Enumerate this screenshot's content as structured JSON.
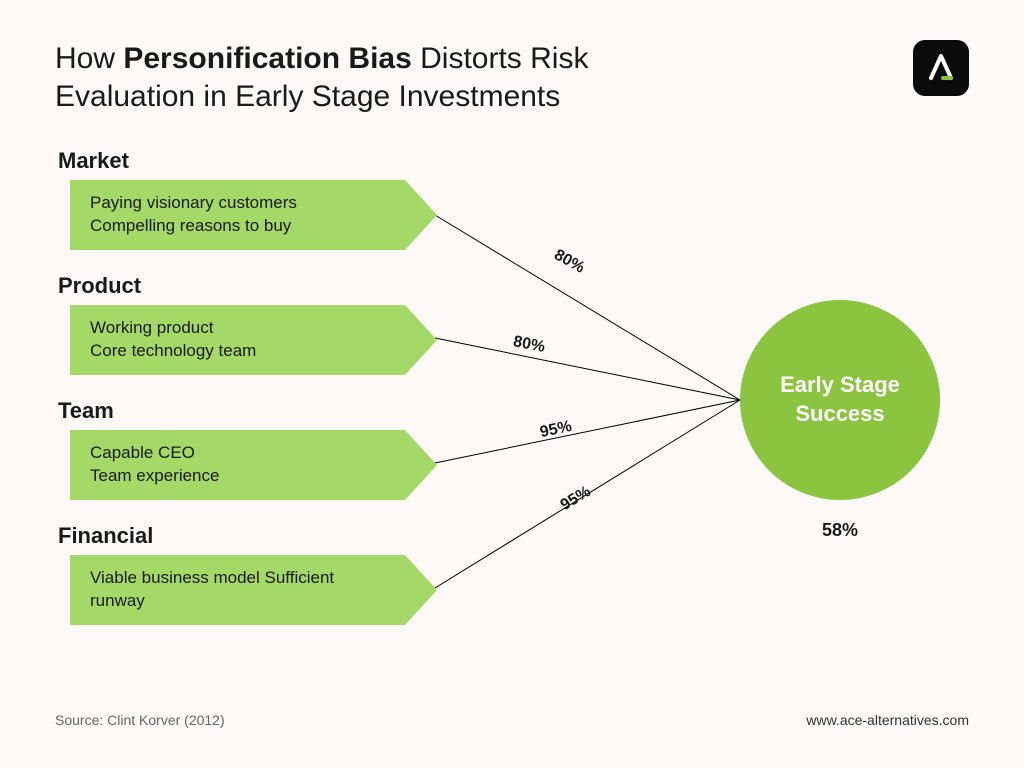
{
  "chart_data": {
    "type": "diagram",
    "title_pre": "How ",
    "title_bold": "Personification Bias",
    "title_post": " Distorts Risk Evaluation in Early Stage Investments",
    "result_label": "Early Stage Success",
    "result_value": "58%",
    "factors": [
      {
        "category": "Market",
        "line1": "Paying visionary customers",
        "line2": "Compelling reasons to buy",
        "weight": "80%"
      },
      {
        "category": "Product",
        "line1": "Working product",
        "line2": "Core technology team",
        "weight": "80%"
      },
      {
        "category": "Team",
        "line1": "Capable CEO",
        "line2": "Team experience",
        "weight": "95%"
      },
      {
        "category": "Financial",
        "line1": "Viable business model Sufficient runway",
        "line2": "",
        "weight": "95%"
      }
    ]
  },
  "footer": {
    "source": "Source: Clint Korver (2012)",
    "url": "www.ace-alternatives.com"
  }
}
